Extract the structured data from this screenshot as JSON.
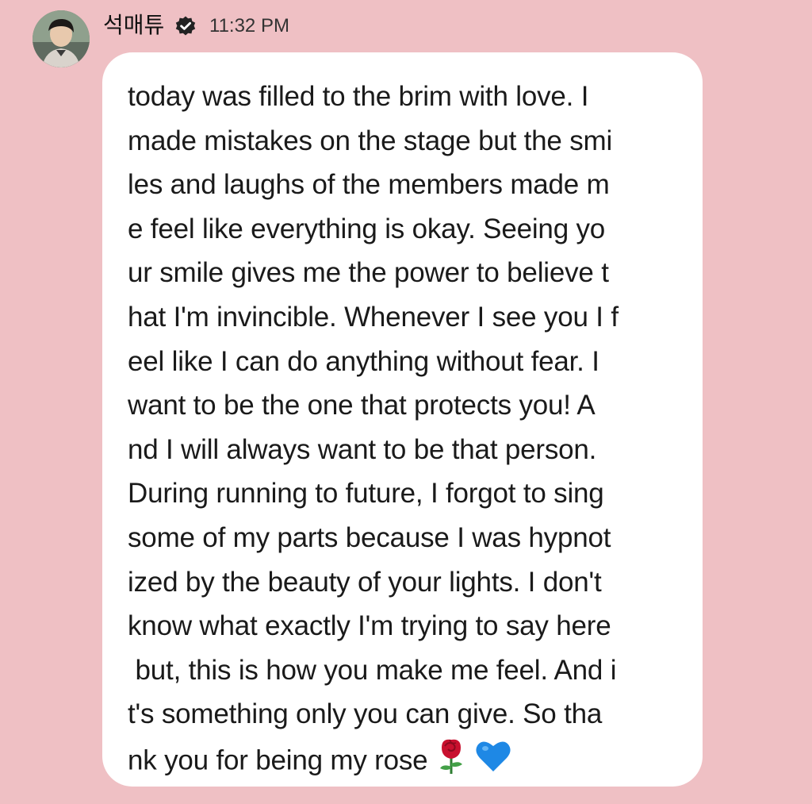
{
  "header": {
    "username": "석매튜",
    "time": "11:32 PM",
    "verified_icon": "verified-check-icon",
    "avatar_icon": "profile-avatar"
  },
  "message": {
    "lines": [
      "today was filled to the brim with love. I",
      "made mistakes on the stage but the smi",
      "les and laughs of the members made m",
      "e feel like everything is okay. Seeing yo",
      "ur smile gives me the power to believe t",
      "hat I'm invincible. Whenever I see you I f",
      "eel like I can do anything without fear. I",
      "want to be the one that protects you! A",
      "nd I will always want to be that person.",
      "During running to future, I forgot to sing",
      "some of my parts because I was hypnot",
      "ized by the beauty of your lights. I don't",
      "know what exactly I'm trying to say here",
      " but, this is how you make me feel. And i",
      "t's something only you can give. So tha",
      "nk you for being my rose"
    ],
    "emojis": [
      "rose-emoji",
      "blue-heart-emoji"
    ]
  },
  "colors": {
    "background": "#efc0c4",
    "bubble": "#ffffff",
    "text": "#1a1a1a",
    "heart": "#1e88e5",
    "rose": "#c8102e"
  }
}
